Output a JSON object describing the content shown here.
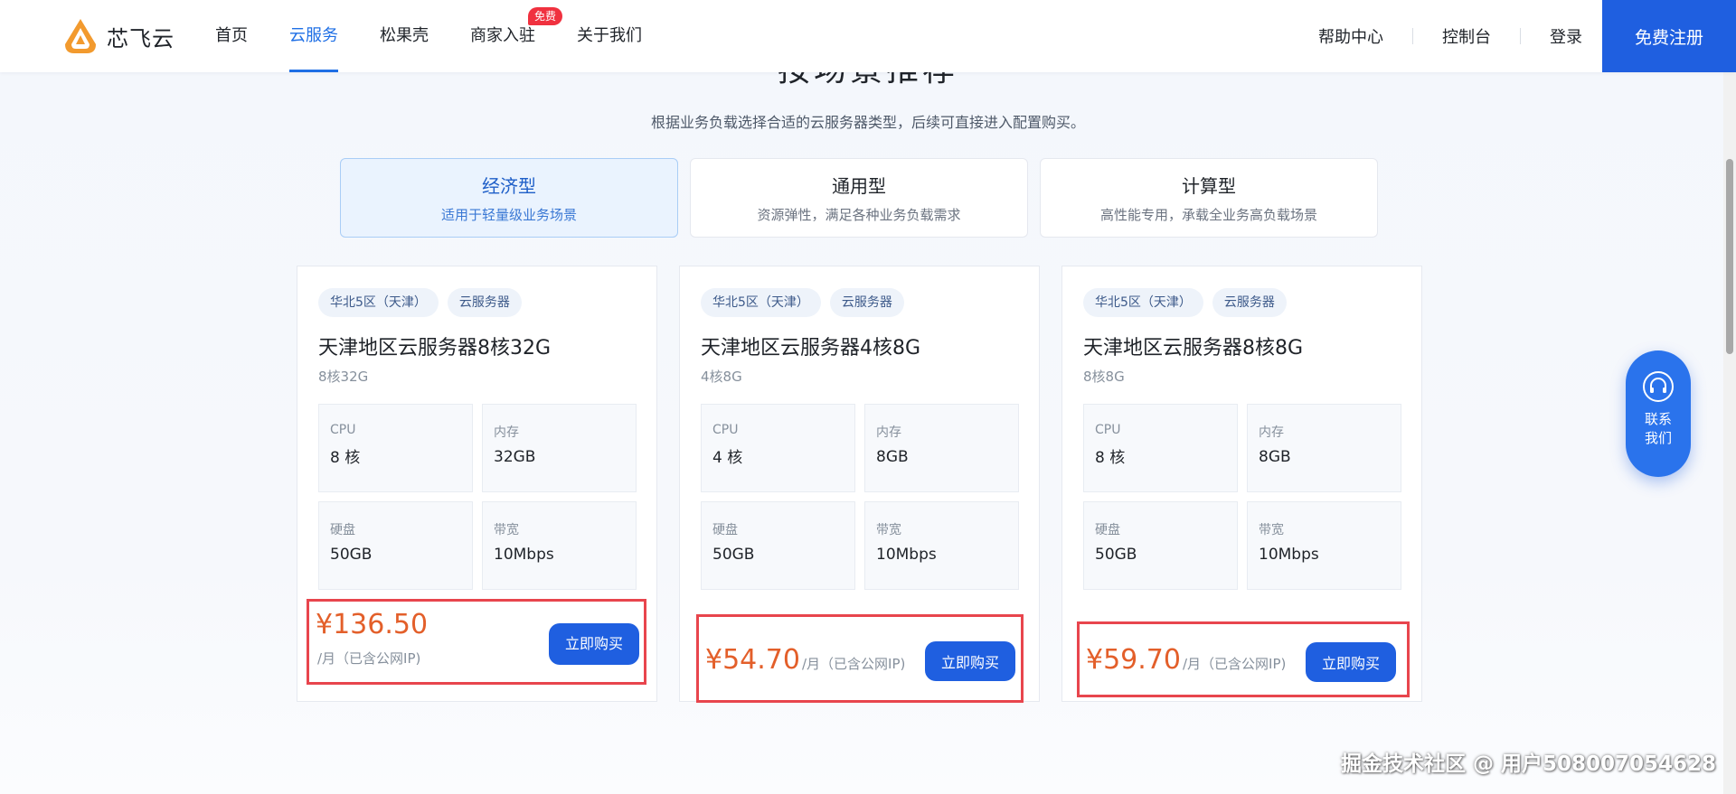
{
  "header": {
    "logo_text": "芯飞云",
    "nav": [
      {
        "label": "首页"
      },
      {
        "label": "云服务"
      },
      {
        "label": "松果壳"
      },
      {
        "label": "商家入驻",
        "badge": "免费"
      },
      {
        "label": "关于我们"
      }
    ],
    "active_nav": "云服务",
    "right_links": [
      "帮助中心",
      "控制台",
      "登录"
    ],
    "register_label": "免费注册"
  },
  "section": {
    "title": "按场景推荐",
    "subtitle": "根据业务负载选择合适的云服务器类型，后续可直接进入配置购买。"
  },
  "types": [
    {
      "name": "经济型",
      "desc": "适用于轻量级业务场景"
    },
    {
      "name": "通用型",
      "desc": "资源弹性，满足各种业务负载需求"
    },
    {
      "name": "计算型",
      "desc": "高性能专用，承载全业务高负载场景"
    }
  ],
  "active_type": "经济型",
  "cards": [
    {
      "tags": [
        "华北5区（天津）",
        "云服务器"
      ],
      "title": "天津地区云服务器8核32G",
      "sub": "8核32G",
      "specs": [
        {
          "label": "CPU",
          "value": "8 核"
        },
        {
          "label": "内存",
          "value": "32GB"
        },
        {
          "label": "硬盘",
          "value": "50GB"
        },
        {
          "label": "带宽",
          "value": "10Mbps"
        }
      ],
      "price": "¥136.50",
      "unit": "/月（已含公网IP)",
      "buy_label": "立即购买"
    },
    {
      "tags": [
        "华北5区（天津）",
        "云服务器"
      ],
      "title": "天津地区云服务器4核8G",
      "sub": "4核8G",
      "specs": [
        {
          "label": "CPU",
          "value": "4 核"
        },
        {
          "label": "内存",
          "value": "8GB"
        },
        {
          "label": "硬盘",
          "value": "50GB"
        },
        {
          "label": "带宽",
          "value": "10Mbps"
        }
      ],
      "price": "¥54.70",
      "unit": "/月（已含公网IP)",
      "buy_label": "立即购买"
    },
    {
      "tags": [
        "华北5区（天津）",
        "云服务器"
      ],
      "title": "天津地区云服务器8核8G",
      "sub": "8核8G",
      "specs": [
        {
          "label": "CPU",
          "value": "8 核"
        },
        {
          "label": "内存",
          "value": "8GB"
        },
        {
          "label": "硬盘",
          "value": "50GB"
        },
        {
          "label": "带宽",
          "value": "10Mbps"
        }
      ],
      "price": "¥59.70",
      "unit": "/月（已含公网IP)",
      "buy_label": "立即购买"
    }
  ],
  "contact": {
    "label": "联系我们",
    "icon": "headset-icon"
  },
  "watermark": "掘金技术社区 @ 用户508007054628",
  "colors": {
    "primary": "#1f5fe0",
    "price": "#e35f2a",
    "highlight_border": "#e8454d",
    "badge": "#f0313f"
  }
}
